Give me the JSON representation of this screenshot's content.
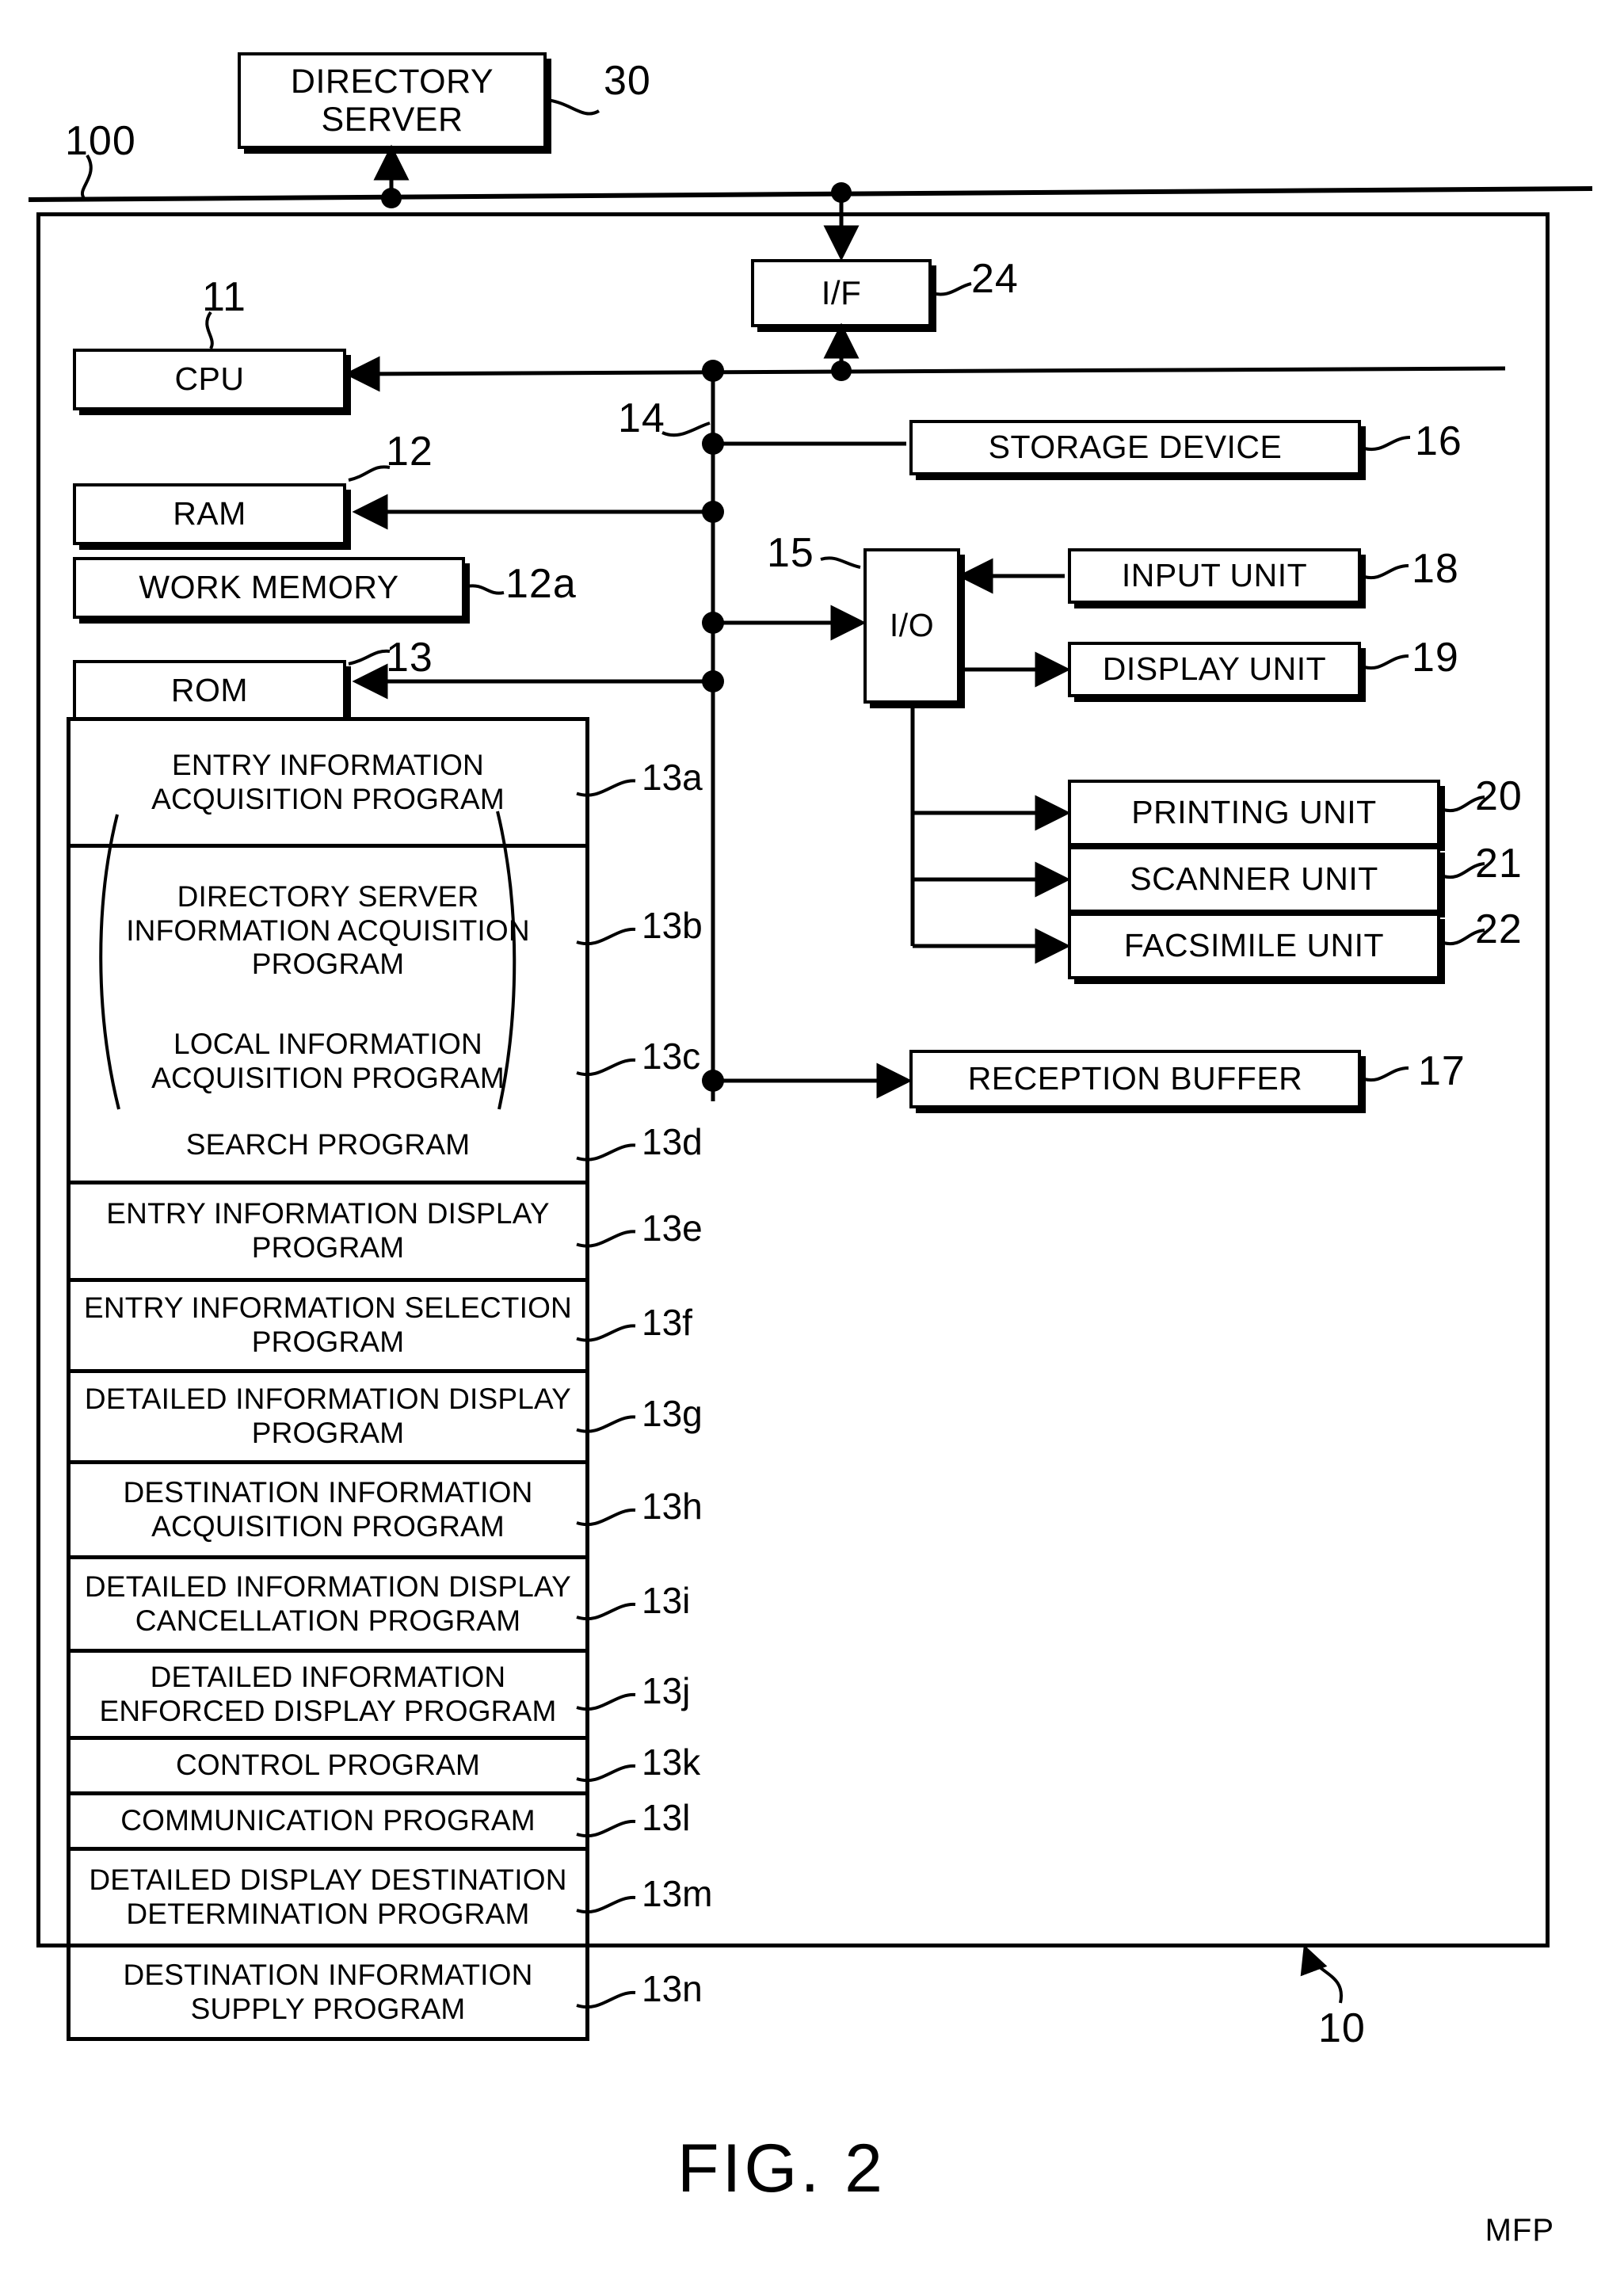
{
  "figure": {
    "caption": "FIG. 2",
    "system_ref": "100",
    "mfp_ref": "10",
    "mfp_label": "MFP"
  },
  "nodes": {
    "directory_server": {
      "label": "DIRECTORY SERVER",
      "ref": "30"
    },
    "interface": {
      "label": "I/F",
      "ref": "24"
    },
    "cpu": {
      "label": "CPU",
      "ref": "11"
    },
    "ram": {
      "label": "RAM",
      "ref": "12"
    },
    "work_memory": {
      "label": "WORK MEMORY",
      "ref": "12a"
    },
    "rom": {
      "label": "ROM",
      "ref": "13"
    },
    "bus": {
      "ref": "14"
    },
    "io": {
      "label": "I/O",
      "ref": "15"
    },
    "storage_device": {
      "label": "STORAGE DEVICE",
      "ref": "16"
    },
    "reception_buffer": {
      "label": "RECEPTION BUFFER",
      "ref": "17"
    },
    "input_unit": {
      "label": "INPUT UNIT",
      "ref": "18"
    },
    "display_unit": {
      "label": "DISPLAY UNIT",
      "ref": "19"
    },
    "printing_unit": {
      "label": "PRINTING UNIT",
      "ref": "20"
    },
    "scanner_unit": {
      "label": "SCANNER UNIT",
      "ref": "21"
    },
    "facsimile_unit": {
      "label": "FACSIMILE UNIT",
      "ref": "22"
    }
  },
  "rom_programs": [
    {
      "ref": "13a",
      "label": "ENTRY INFORMATION ACQUISITION PROGRAM"
    },
    {
      "ref": "13b",
      "label": "DIRECTORY SERVER INFORMATION ACQUISITION PROGRAM"
    },
    {
      "ref": "13c",
      "label": "LOCAL INFORMATION ACQUISITION PROGRAM"
    },
    {
      "ref": "13d",
      "label": "SEARCH PROGRAM"
    },
    {
      "ref": "13e",
      "label": "ENTRY INFORMATION DISPLAY PROGRAM"
    },
    {
      "ref": "13f",
      "label": "ENTRY INFORMATION SELECTION PROGRAM"
    },
    {
      "ref": "13g",
      "label": "DETAILED INFORMATION DISPLAY PROGRAM"
    },
    {
      "ref": "13h",
      "label": "DESTINATION INFORMATION ACQUISITION PROGRAM"
    },
    {
      "ref": "13i",
      "label": "DETAILED INFORMATION DISPLAY CANCELLATION PROGRAM"
    },
    {
      "ref": "13j",
      "label": "DETAILED INFORMATION ENFORCED DISPLAY  PROGRAM"
    },
    {
      "ref": "13k",
      "label": "CONTROL PROGRAM"
    },
    {
      "ref": "13l",
      "label": "COMMUNICATION PROGRAM"
    },
    {
      "ref": "13m",
      "label": "DETAILED DISPLAY DESTINATION DETERMINATION PROGRAM"
    },
    {
      "ref": "13n",
      "label": "DESTINATION INFORMATION SUPPLY PROGRAM"
    }
  ]
}
